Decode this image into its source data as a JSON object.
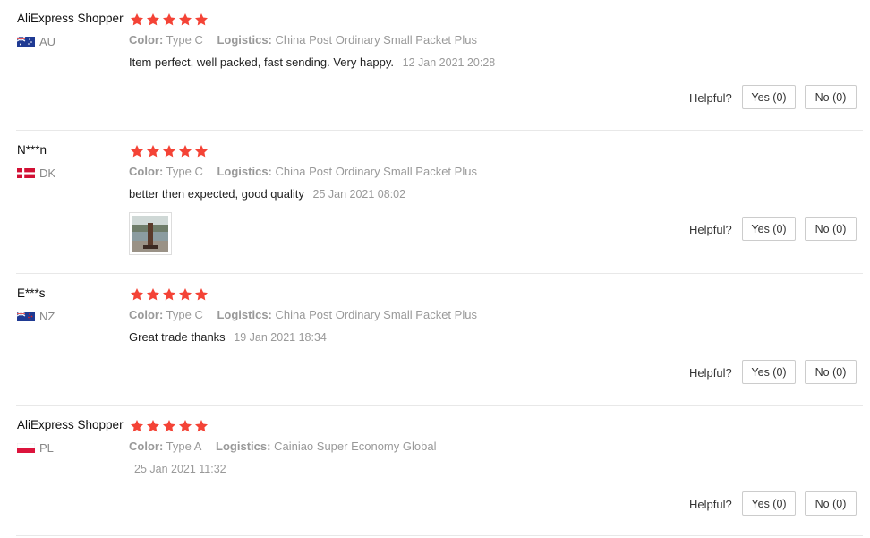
{
  "colors": {
    "star": "#f44336",
    "border": "#e8e8e8"
  },
  "helpful_label": "Helpful?",
  "reviews": [
    {
      "buyer": "AliExpress Shopper",
      "country_code": "AU",
      "flag": "australia-flag-icon",
      "rating": 5,
      "color_label": "Color:",
      "color_value": "Type C",
      "logistics_label": "Logistics:",
      "logistics_value": "China Post Ordinary Small Packet Plus",
      "text": "Item perfect, well packed, fast sending. Very happy.",
      "date": "12 Jan 2021 20:28",
      "yes": "Yes (0)",
      "no": "No (0)"
    },
    {
      "buyer": "N***n",
      "country_code": "DK",
      "flag": "denmark-flag-icon",
      "rating": 5,
      "color_label": "Color:",
      "color_value": "Type C",
      "logistics_label": "Logistics:",
      "logistics_value": "China Post Ordinary Small Packet Plus",
      "text": "better then expected, good quality",
      "date": "25 Jan 2021 08:02",
      "yes": "Yes (0)",
      "no": "No (0)"
    },
    {
      "buyer": "E***s",
      "country_code": "NZ",
      "flag": "new-zealand-flag-icon",
      "rating": 5,
      "color_label": "Color:",
      "color_value": "Type C",
      "logistics_label": "Logistics:",
      "logistics_value": "China Post Ordinary Small Packet Plus",
      "text": "Great trade thanks",
      "date": "19 Jan 2021 18:34",
      "yes": "Yes (0)",
      "no": "No (0)"
    },
    {
      "buyer": "AliExpress Shopper",
      "country_code": "PL",
      "flag": "poland-flag-icon",
      "rating": 5,
      "color_label": "Color:",
      "color_value": "Type A",
      "logistics_label": "Logistics:",
      "logistics_value": "Cainiao Super Economy Global",
      "text": "",
      "date": "25 Jan 2021 11:32",
      "yes": "Yes (0)",
      "no": "No (0)"
    }
  ]
}
